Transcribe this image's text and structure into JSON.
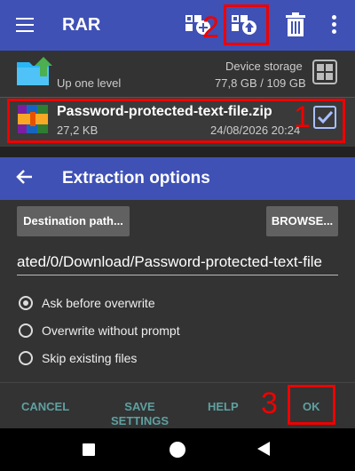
{
  "app": {
    "title": "RAR"
  },
  "list": {
    "up_label": "Up one level",
    "storage_label": "Device storage",
    "storage_size": "77,8 GB / 109 GB",
    "file": {
      "name": "Password-protected-text-file.zip",
      "size": "27,2 KB",
      "date": "24/08/2026 20:24",
      "checked": true
    }
  },
  "annotations": {
    "m1": "1",
    "m2": "2",
    "m3": "3"
  },
  "dialog": {
    "title": "Extraction options",
    "destination_button": "Destination path...",
    "browse_button": "BROWSE...",
    "path_value": "ated/0/Download/Password-protected-text-file",
    "options": [
      {
        "label": "Ask before overwrite",
        "selected": true
      },
      {
        "label": "Overwrite without prompt",
        "selected": false
      },
      {
        "label": "Skip existing files",
        "selected": false
      }
    ],
    "buttons": {
      "cancel": "CANCEL",
      "save_line1": "SAVE",
      "save_line2": "SETTINGS",
      "help": "HELP",
      "ok": "OK"
    }
  },
  "icons": [
    "menu-icon",
    "add-to-archive-icon",
    "extract-icon",
    "trash-icon",
    "more-vert-icon",
    "folder-up-icon",
    "grid-view-icon",
    "zip-file-icon",
    "checkbox-icon",
    "back-arrow-icon"
  ],
  "colors": {
    "accent": "#3f51b5",
    "highlight": "#e00000",
    "dialog_button_text": "#5fa0a0"
  }
}
